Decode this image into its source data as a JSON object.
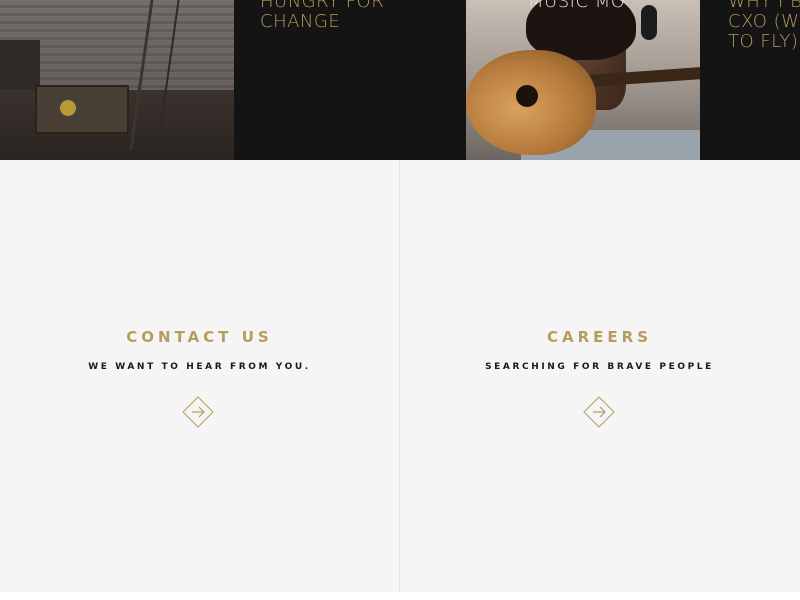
{
  "strip": {
    "tiles": [
      {
        "title": "",
        "kind": "photo"
      },
      {
        "title": "HUNGRY FOR\nCHANGE",
        "kind": "text"
      },
      {
        "title": "MUSIC MO",
        "kind": "photo"
      },
      {
        "title": "WHY I BE\nCXO (WH\nTO FLY)",
        "kind": "text"
      }
    ]
  },
  "cards": [
    {
      "title": "CONTACT US",
      "subtitle": "WE WANT TO HEAR FROM YOU.",
      "arrow_icon": "arrow-right-diamond-icon"
    },
    {
      "title": "CAREERS",
      "subtitle": "SEARCHING FOR BRAVE PEOPLE",
      "arrow_icon": "arrow-right-diamond-icon"
    }
  ],
  "colors": {
    "accent_gold": "#b79d5b",
    "dark_bg": "#141414",
    "light_bg": "#f5f5f5",
    "text_dark": "#1a1a1a"
  }
}
